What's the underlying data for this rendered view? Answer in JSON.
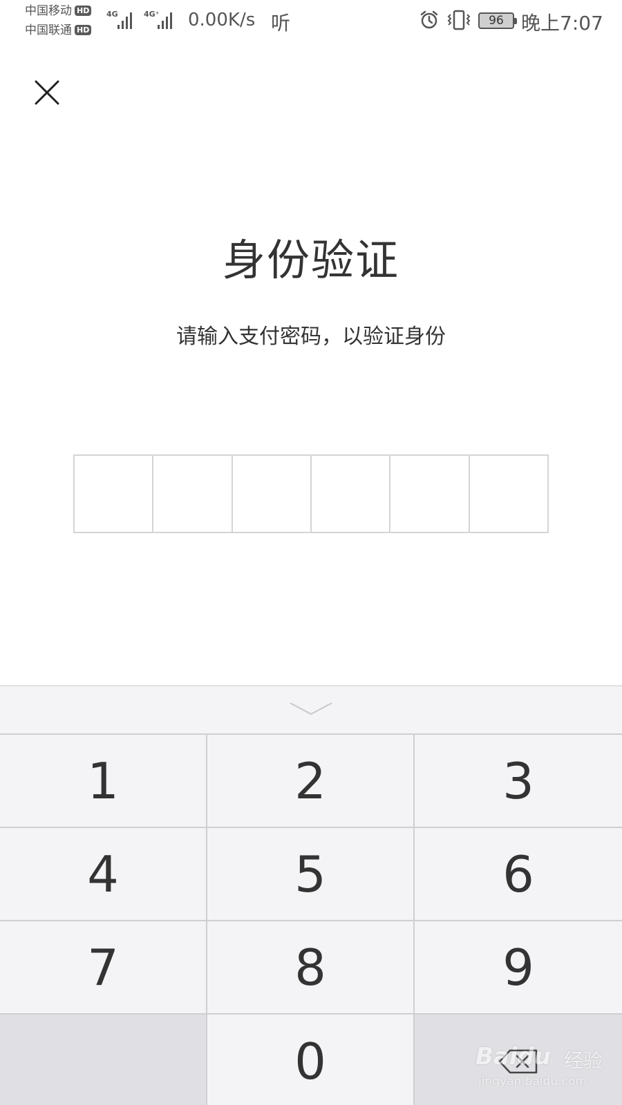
{
  "status_bar": {
    "carrier_1": "中国移动",
    "carrier_2": "中国联通",
    "hd_badge": "HD",
    "network_1": "4G",
    "network_2": "4G⁺",
    "net_speed": "0.00K/s",
    "ting": "听",
    "battery": "96",
    "time": "晚上7:07"
  },
  "close": {
    "icon": "close-icon"
  },
  "title": "身份验证",
  "subtitle": "请输入支付密码，以验证身份",
  "pin": {
    "length": 6,
    "entered": 0
  },
  "keyboard": {
    "collapse_icon": "chevron-down-icon",
    "keys": [
      "1",
      "2",
      "3",
      "4",
      "5",
      "6",
      "7",
      "8",
      "9",
      "",
      "0",
      ""
    ],
    "backspace_icon": "backspace-icon"
  },
  "watermark": {
    "brand": "Baidu",
    "cn": "经验",
    "url": "jingyan.baidu.com"
  },
  "colors": {
    "text": "#333333",
    "border": "#d4d4d4",
    "keyboard_bg": "#f4f3f6",
    "key_dark": "#e0dfe3"
  }
}
